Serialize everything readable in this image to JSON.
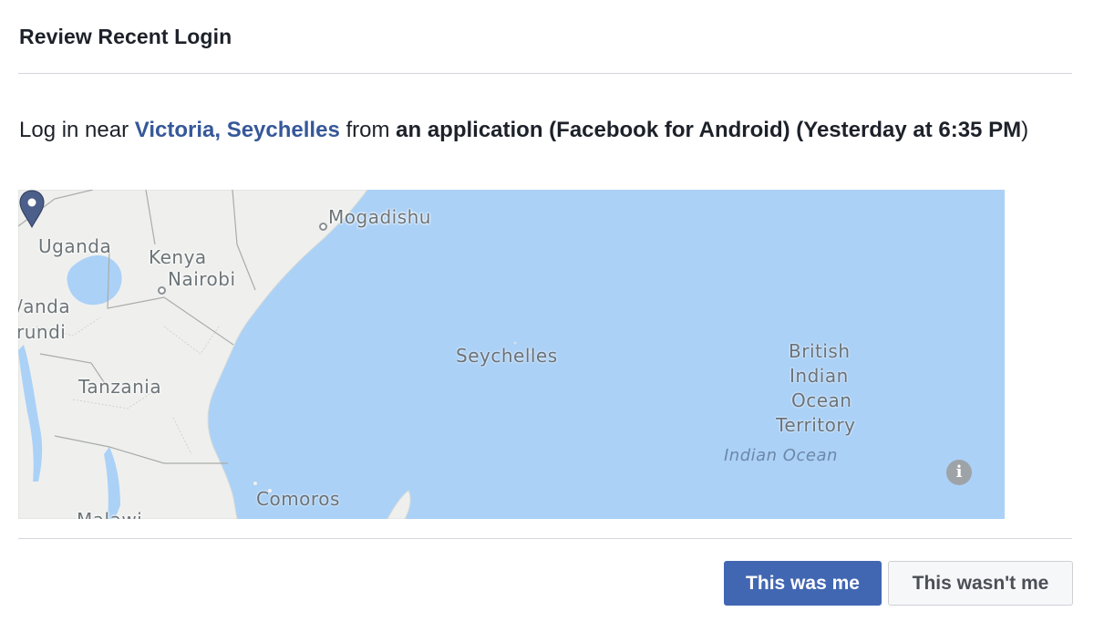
{
  "dialog": {
    "title": "Review Recent Login"
  },
  "message": {
    "prefix": "Log in near ",
    "location": "Victoria, Seychelles",
    "from_text": " from ",
    "source": "an application (Facebook for Android)",
    "time": " (Yesterday at 6:35 PM",
    "time_close": ")"
  },
  "map": {
    "labels": {
      "mogadishu": "Mogadishu",
      "uganda": "Uganda",
      "kenya": "Kenya",
      "nairobi": "Nairobi",
      "rwanda_partial": "/anda",
      "burundi_partial": "rundi",
      "seychelles": "Seychelles",
      "tanzania": "Tanzania",
      "british_line1": "British",
      "british_line2": "Indian",
      "british_line3": "Ocean",
      "british_line4": "Territory",
      "indian_ocean": "Indian Ocean",
      "comoros": "Comoros",
      "malawi_partial": "Malawi"
    },
    "pin_icon": "map-pin-icon",
    "info_icon_glyph": "i",
    "colors": {
      "water": "#abd1f7",
      "land": "#eff0ee",
      "pin": "#4b5f8a"
    }
  },
  "actions": {
    "confirm_label": "This was me",
    "deny_label": "This wasn't me"
  },
  "colors": {
    "primary_button": "#4267b2",
    "link": "#365899"
  }
}
